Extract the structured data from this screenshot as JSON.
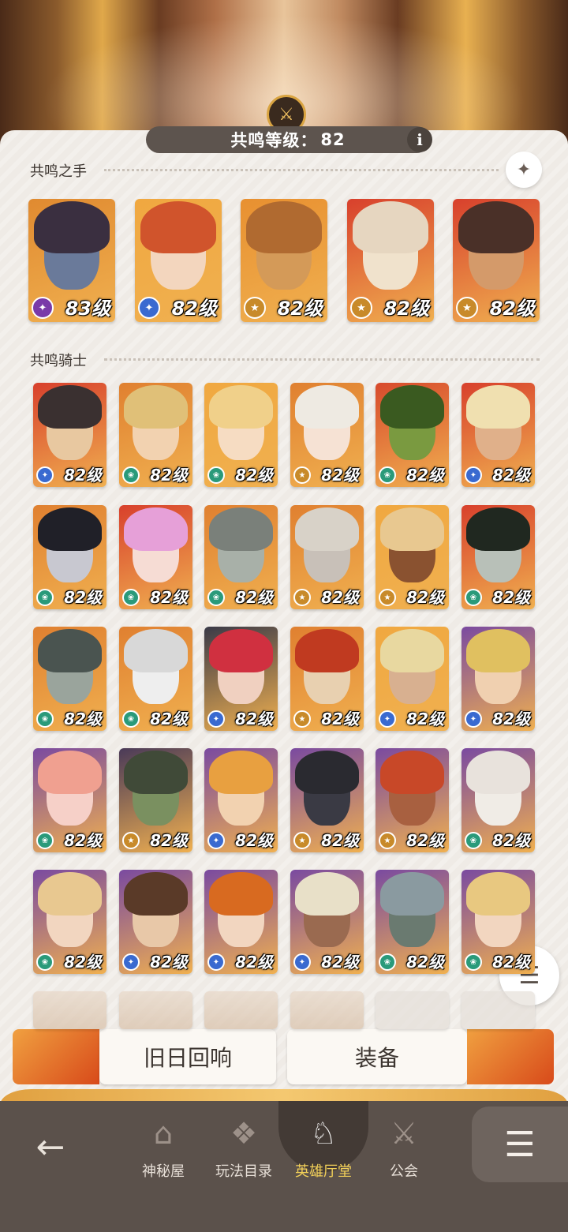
{
  "header": {
    "resonance_label": "共鸣等级：",
    "resonance_level": "82",
    "info_icon": "i"
  },
  "sections": {
    "hand_title": "共鸣之手",
    "knights_title": "共鸣骑士"
  },
  "hand_cards": [
    {
      "level": "83级",
      "badge": "purple",
      "hair": "#3a2f40",
      "face": "#6a7a9a",
      "bg": "#e08a30"
    },
    {
      "level": "82级",
      "badge": "blue",
      "hair": "#d0542c",
      "face": "#f3d6be",
      "bg": "#f0a840"
    },
    {
      "level": "82级",
      "badge": "gold",
      "hair": "#b06a30",
      "face": "#d49a58",
      "bg": "#e89030"
    },
    {
      "level": "82级",
      "badge": "gold",
      "hair": "#e6d6c0",
      "face": "#f0e2cc",
      "bg": "#d8402c"
    },
    {
      "level": "82级",
      "badge": "gold",
      "hair": "#4a3028",
      "face": "#d49a6a",
      "bg": "#d8402c"
    }
  ],
  "knight_cards": [
    {
      "level": "82级",
      "badge": "blue",
      "hair": "#3a3030",
      "face": "#e8c8a0",
      "bg": "#d8402c"
    },
    {
      "level": "82级",
      "badge": "teal",
      "hair": "#e0c078",
      "face": "#f2d2b0",
      "bg": "#e08030"
    },
    {
      "level": "82级",
      "badge": "teal",
      "hair": "#f0d08a",
      "face": "#f6dcc2",
      "bg": "#f0a840"
    },
    {
      "level": "82级",
      "badge": "gold",
      "hair": "#eeeae2",
      "face": "#f6e2d4",
      "bg": "#e08030"
    },
    {
      "level": "82级",
      "badge": "teal",
      "hair": "#3a5a20",
      "face": "#7a9a40",
      "bg": "#d84a2c"
    },
    {
      "level": "82级",
      "badge": "blue",
      "hair": "#f0e0b0",
      "face": "#e0b08a",
      "bg": "#d8402c"
    },
    {
      "level": "82级",
      "badge": "teal",
      "hair": "#202028",
      "face": "#c8c8d0",
      "bg": "#e08030"
    },
    {
      "level": "82级",
      "badge": "teal",
      "hair": "#e6a0d8",
      "face": "#f6dcd4",
      "bg": "#d8402c"
    },
    {
      "level": "82级",
      "badge": "teal",
      "hair": "#7a807a",
      "face": "#a8b0a8",
      "bg": "#e08030"
    },
    {
      "level": "82级",
      "badge": "gold",
      "hair": "#d8d2c8",
      "face": "#c8c0b8",
      "bg": "#e08030"
    },
    {
      "level": "82级",
      "badge": "gold",
      "hair": "#e8c890",
      "face": "#8a5230",
      "bg": "#f0a840"
    },
    {
      "level": "82级",
      "badge": "teal",
      "hair": "#202820",
      "face": "#b8c0b8",
      "bg": "#d8402c"
    },
    {
      "level": "82级",
      "badge": "teal",
      "hair": "#4a5450",
      "face": "#9aa49c",
      "bg": "#e08030"
    },
    {
      "level": "82级",
      "badge": "teal",
      "hair": "#d8d8d8",
      "face": "#eeeeee",
      "bg": "#e08030"
    },
    {
      "level": "82级",
      "badge": "blue",
      "hair": "#d03040",
      "face": "#f0d0c0",
      "bg": "#3a3a48"
    },
    {
      "level": "82级",
      "badge": "gold",
      "hair": "#c03a20",
      "face": "#e8d0b0",
      "bg": "#e08030"
    },
    {
      "level": "82级",
      "badge": "blue",
      "hair": "#e8d8a0",
      "face": "#d8b090",
      "bg": "#f0a840"
    },
    {
      "level": "82级",
      "badge": "blue",
      "hair": "#e0c060",
      "face": "#f0d0b0",
      "bg": "#7a4aa0"
    },
    {
      "level": "82级",
      "badge": "teal",
      "hair": "#f0a090",
      "face": "#f6d0c8",
      "bg": "#7a4aa0"
    },
    {
      "level": "82级",
      "badge": "gold",
      "hair": "#404a38",
      "face": "#7a9060",
      "bg": "#4a3a58"
    },
    {
      "level": "82级",
      "badge": "blue",
      "hair": "#e8a040",
      "face": "#f2d2b0",
      "bg": "#7a4aa0"
    },
    {
      "level": "82级",
      "badge": "gold",
      "hair": "#2a2a30",
      "face": "#3a3a44",
      "bg": "#7a4aa0"
    },
    {
      "level": "82级",
      "badge": "gold",
      "hair": "#c84828",
      "face": "#a86040",
      "bg": "#7a4aa0"
    },
    {
      "level": "82级",
      "badge": "teal",
      "hair": "#e8e2dc",
      "face": "#f0ece6",
      "bg": "#7a4aa0"
    },
    {
      "level": "82级",
      "badge": "teal",
      "hair": "#e8c890",
      "face": "#f2d6c0",
      "bg": "#7a4aa0"
    },
    {
      "level": "82级",
      "badge": "blue",
      "hair": "#5a3a28",
      "face": "#e8c8a8",
      "bg": "#7a4aa0"
    },
    {
      "level": "82级",
      "badge": "blue",
      "hair": "#d86a20",
      "face": "#f2d6c0",
      "bg": "#7a4aa0"
    },
    {
      "level": "82级",
      "badge": "blue",
      "hair": "#e8e0c8",
      "face": "#9a6a50",
      "bg": "#7a4aa0"
    },
    {
      "level": "82级",
      "badge": "teal",
      "hair": "#8a9aa0",
      "face": "#6a7a70",
      "bg": "#7a4aa0"
    },
    {
      "level": "82级",
      "badge": "teal",
      "hair": "#e8c880",
      "face": "#f2d6c0",
      "bg": "#7a4aa0"
    }
  ],
  "bottom_buttons": {
    "echo_label": "旧日回响",
    "equip_label": "装备"
  },
  "nav": {
    "items": [
      {
        "label": "神秘屋",
        "icon": "mystery-house-icon"
      },
      {
        "label": "玩法目录",
        "icon": "catalog-icon"
      },
      {
        "label": "英雄厅堂",
        "icon": "hero-hall-icon"
      },
      {
        "label": "公会",
        "icon": "guild-icon"
      }
    ],
    "active_index": 2
  },
  "colors": {
    "badge_purple": "#7a3aa8",
    "badge_blue": "#3a6ad0",
    "badge_teal": "#2a9a7a",
    "badge_gold": "#c88a2a",
    "nav_active": "#f2d058"
  }
}
